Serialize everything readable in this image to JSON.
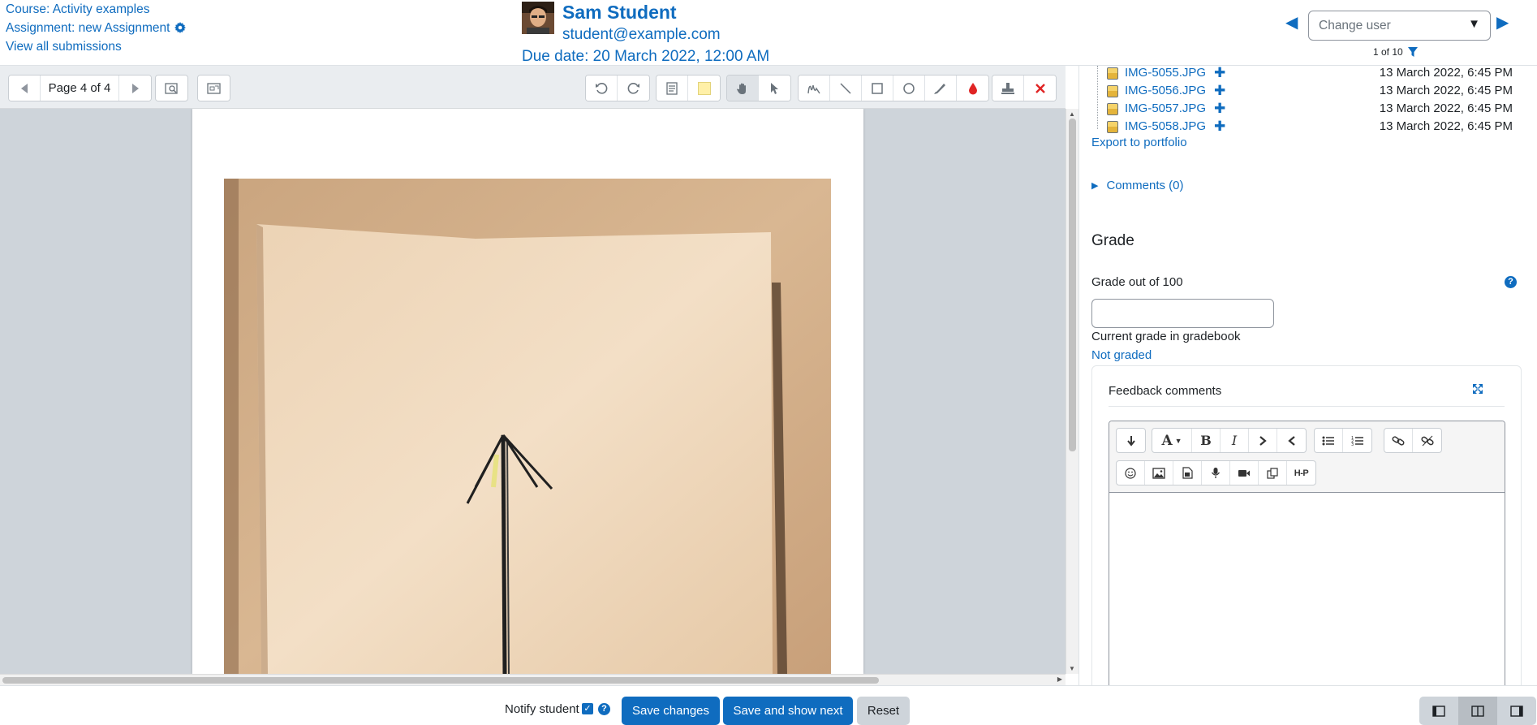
{
  "header": {
    "course_link": "Course: Activity examples",
    "assignment_link": "Assignment: new Assignment",
    "view_all_link": "View all submissions",
    "student_name": "Sam Student",
    "student_email": "student@example.com",
    "due_date": "Due date: 20 March 2022, 12:00 AM",
    "change_user_placeholder": "Change user",
    "user_count": "1 of 10"
  },
  "toolbar": {
    "page_label": "Page 4 of 4"
  },
  "files": [
    {
      "name": "IMG-5055.JPG",
      "date": "13 March 2022, 6:45 PM"
    },
    {
      "name": "IMG-5056.JPG",
      "date": "13 March 2022, 6:45 PM"
    },
    {
      "name": "IMG-5057.JPG",
      "date": "13 March 2022, 6:45 PM"
    },
    {
      "name": "IMG-5058.JPG",
      "date": "13 March 2022, 6:45 PM"
    }
  ],
  "panel": {
    "export_link": "Export to portfolio",
    "comments_toggle": "Comments (0)",
    "grade_heading": "Grade",
    "grade_label": "Grade out of 100",
    "grade_value": "",
    "current_grade_label": "Current grade in gradebook",
    "current_grade_value": "Not graded",
    "feedback_title": "Feedback comments"
  },
  "bottom": {
    "notify_label": "Notify student",
    "notify_checked": true,
    "save_label": "Save changes",
    "save_next_label": "Save and show next",
    "reset_label": "Reset"
  },
  "colors": {
    "link": "#0f6cbf",
    "primary_button": "#0f6cbf",
    "secondary_button": "#ced4da",
    "viewer_background": "#ced4da",
    "toolbar_background": "#eaedf0"
  }
}
